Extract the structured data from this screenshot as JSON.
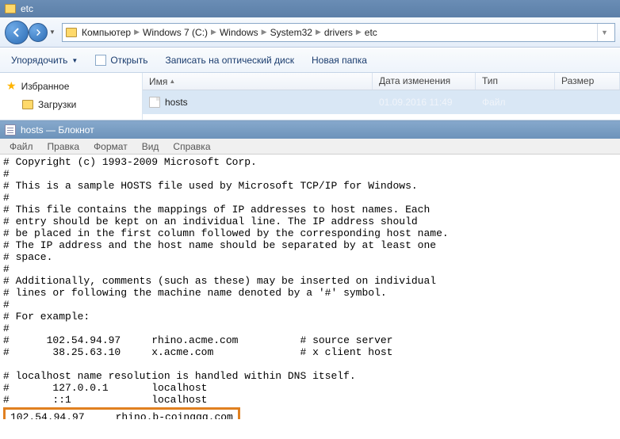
{
  "explorer": {
    "title": "etc",
    "breadcrumb": [
      "Компьютер",
      "Windows 7 (C:)",
      "Windows",
      "System32",
      "drivers",
      "etc"
    ],
    "toolbar": {
      "arrange": "Упорядочить",
      "open": "Открыть",
      "burn": "Записать на оптический диск",
      "newfolder": "Новая папка"
    },
    "navpane": {
      "favorites": "Избранное",
      "downloads": "Загрузки"
    },
    "columns": {
      "name": "Имя",
      "date": "Дата изменения",
      "type": "Тип",
      "size": "Размер"
    },
    "files": [
      {
        "name": "hosts",
        "date": "01.09.2016 11:49",
        "type": "Файл"
      }
    ]
  },
  "notepad": {
    "title": "hosts — Блокнот",
    "menu": {
      "file": "Файл",
      "edit": "Правка",
      "format": "Формат",
      "view": "Вид",
      "help": "Справка"
    },
    "content": {
      "l1": "# Copyright (c) 1993-2009 Microsoft Corp.",
      "l2": "#",
      "l3": "# This is a sample HOSTS file used by Microsoft TCP/IP for Windows.",
      "l4": "#",
      "l5": "# This file contains the mappings of IP addresses to host names. Each",
      "l6": "# entry should be kept on an individual line. The IP address should",
      "l7": "# be placed in the first column followed by the corresponding host name.",
      "l8": "# The IP address and the host name should be separated by at least one",
      "l9": "# space.",
      "l10": "#",
      "l11": "# Additionally, comments (such as these) may be inserted on individual",
      "l12": "# lines or following the machine name denoted by a '#' symbol.",
      "l13": "#",
      "l14": "# For example:",
      "l15": "#",
      "l16": "#      102.54.94.97     rhino.acme.com          # source server",
      "l17": "#       38.25.63.10     x.acme.com              # x client host",
      "l18": "",
      "l19": "# localhost name resolution is handled within DNS itself.",
      "l20": "#       127.0.0.1       localhost",
      "l21": "#       ::1             localhost",
      "highlight": "102.54.94.97     rhino.b-coinggg.com"
    }
  }
}
